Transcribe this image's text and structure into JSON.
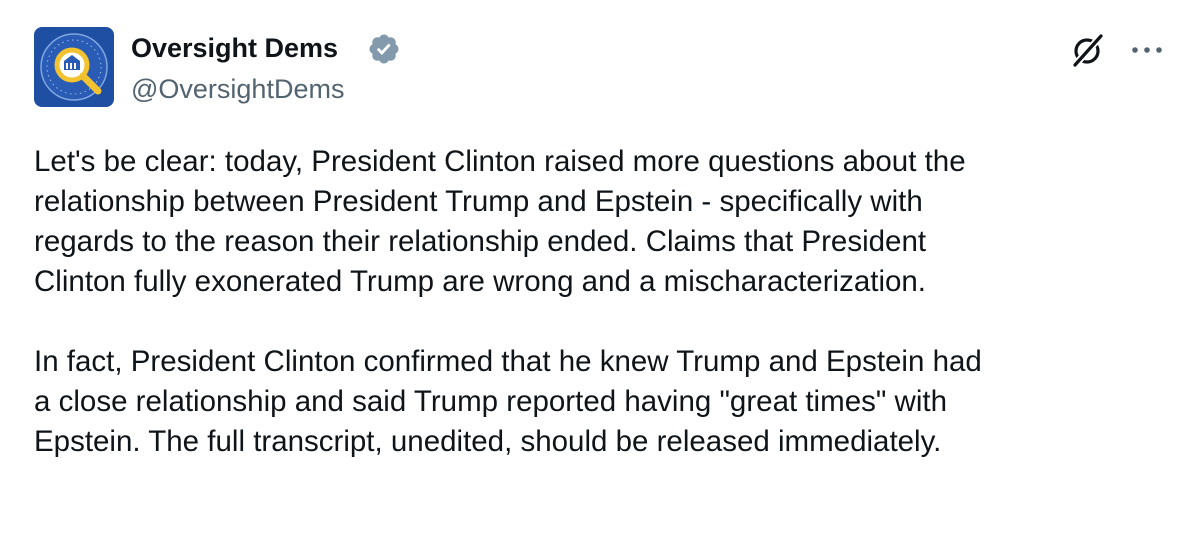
{
  "author": {
    "display_name": "Oversight Dems",
    "handle": "@OversightDems",
    "verified": true,
    "verified_color": "#829aab",
    "avatar_bg": "#1f4fa3",
    "avatar_accent": "#f2c230"
  },
  "actions": {
    "grok_icon": "grok-slash-icon",
    "more_icon": "more-dots-icon"
  },
  "tweet": {
    "paragraphs": [
      {
        "lines": [
          "Let's be clear: today, President Clinton raised more questions about the",
          "relationship between President Trump and Epstein - specifically with",
          "regards to the reason their relationship ended. Claims that President",
          "Clinton fully exonerated Trump are wrong and a mischaracterization."
        ]
      },
      {
        "lines": [
          "In fact, President Clinton confirmed that he knew Trump and Epstein had",
          "a close relationship and said Trump reported having \"great times\" with",
          "Epstein. The full transcript, unedited, should be released immediately."
        ]
      }
    ]
  }
}
